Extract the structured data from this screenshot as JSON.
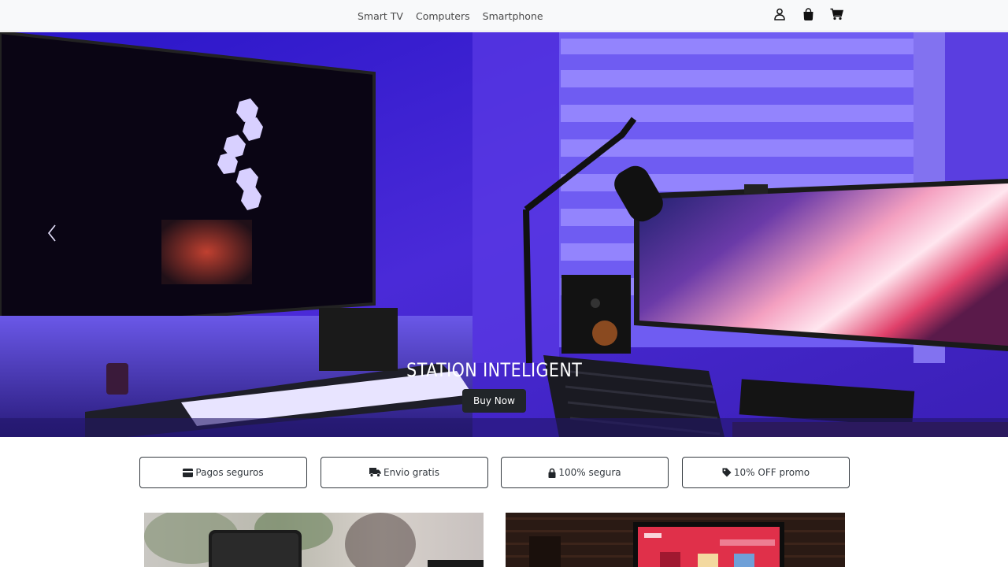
{
  "navbar": {
    "links": [
      "Smart TV",
      "Computers",
      "Smartphone"
    ],
    "icons": [
      "user-icon",
      "shopping-bag-icon",
      "shopping-cart-icon"
    ]
  },
  "hero": {
    "title": "STATION INTELIGENT",
    "button_label": "Buy Now",
    "prev_icon": "chevron-left-icon"
  },
  "features": [
    {
      "icon": "credit-card-icon",
      "label": "Pagos seguros"
    },
    {
      "icon": "truck-icon",
      "label": "Envio gratis"
    },
    {
      "icon": "lock-icon",
      "label": "100% segura"
    },
    {
      "icon": "tag-icon",
      "label": "10% OFF promo"
    }
  ],
  "colors": {
    "navbar_bg": "#f8f9fa",
    "hero_bg": "#3d20c9",
    "button_bg": "#212529",
    "border": "#343a40"
  }
}
